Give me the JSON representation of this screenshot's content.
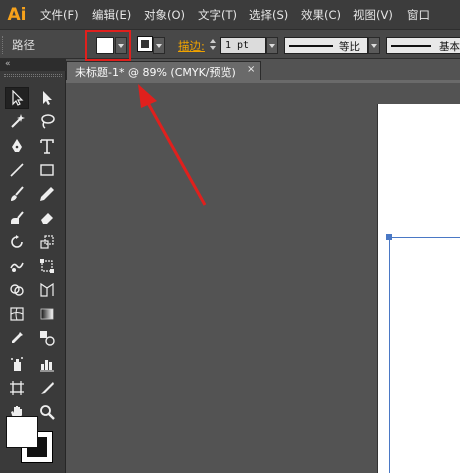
{
  "menubar": {
    "app_logo": "Ai",
    "items": [
      "文件(F)",
      "编辑(E)",
      "对象(O)",
      "文字(T)",
      "选择(S)",
      "效果(C)",
      "视图(V)",
      "窗口"
    ]
  },
  "controlbar": {
    "selection_label": "路径",
    "stroke_label": "描边:",
    "stroke_weight": "1 pt",
    "profile_label": "等比",
    "brush_label": "基本"
  },
  "toolbar": {
    "collapse_glyph": "«",
    "tools": [
      "selection-tool",
      "direct-selection-tool",
      "magic-wand-tool",
      "lasso-tool",
      "pen-tool",
      "type-tool",
      "line-segment-tool",
      "rectangle-tool",
      "paintbrush-tool",
      "pencil-tool",
      "blob-brush-tool",
      "eraser-tool",
      "rotate-tool",
      "scale-tool",
      "warp-tool",
      "free-transform-tool",
      "shape-builder-tool",
      "perspective-grid-tool",
      "mesh-tool",
      "gradient-tool",
      "eyedropper-tool",
      "blend-tool",
      "symbol-sprayer-tool",
      "column-graph-tool",
      "artboard-tool",
      "slice-tool",
      "hand-tool",
      "zoom-tool"
    ]
  },
  "document": {
    "tab_title": "未标题-1* @ 89% (CMYK/预览)",
    "close_glyph": "×"
  },
  "colors": {
    "accent_orange": "#f0a300",
    "annotation_red": "#e0201d",
    "selection_blue": "#4a78c5"
  }
}
